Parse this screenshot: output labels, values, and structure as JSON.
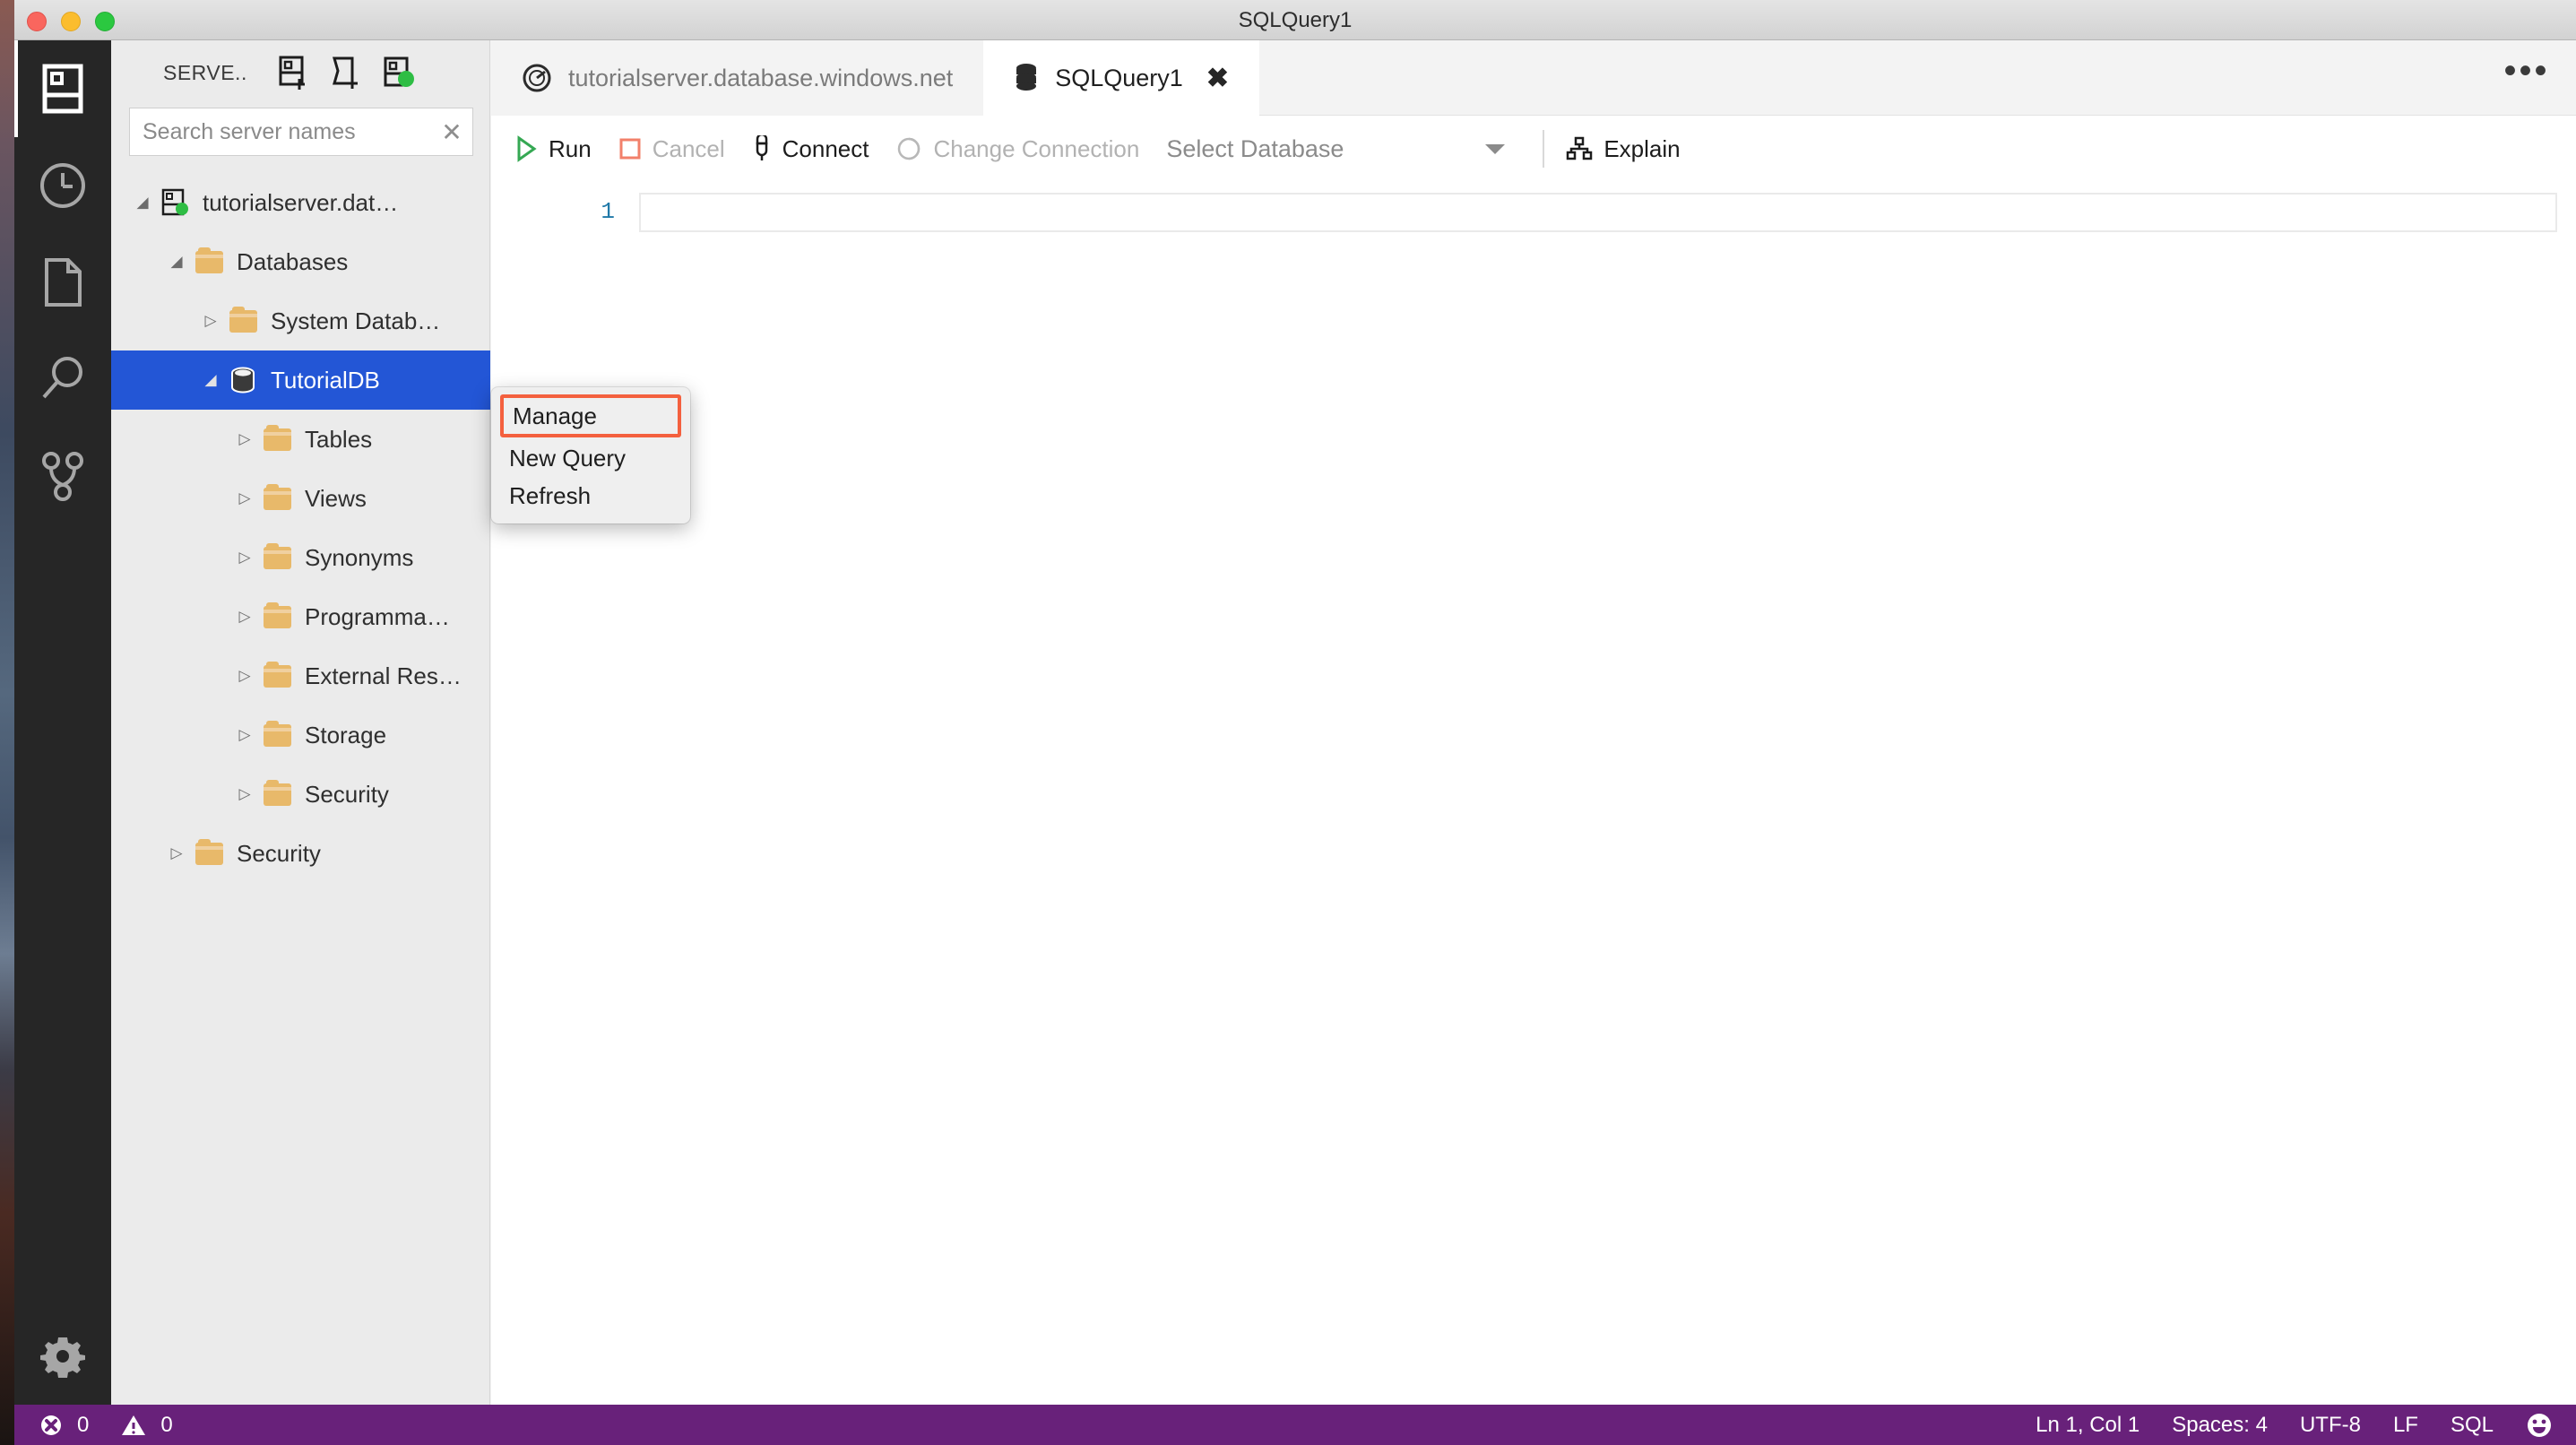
{
  "window": {
    "title": "SQLQuery1",
    "traffic_lights": [
      "close",
      "minimize",
      "maximize"
    ]
  },
  "activity_bar": {
    "items": [
      {
        "name": "servers",
        "icon": "servers-icon",
        "active": true
      },
      {
        "name": "history",
        "icon": "clock-icon",
        "active": false
      },
      {
        "name": "file-explorer",
        "icon": "file-icon",
        "active": false
      },
      {
        "name": "search",
        "icon": "magnifier-icon",
        "active": false
      },
      {
        "name": "source-control",
        "icon": "source-control-icon",
        "active": false
      }
    ],
    "bottom": [
      {
        "name": "settings",
        "icon": "gear-icon"
      }
    ]
  },
  "sidebar": {
    "title": "SERVE..",
    "actions": [
      {
        "name": "add-server",
        "icon": "add-server-icon"
      },
      {
        "name": "add-server-group",
        "icon": "add-server-group-icon"
      },
      {
        "name": "connected-server",
        "icon": "connected-server-icon"
      }
    ],
    "search": {
      "placeholder": "Search server names",
      "value": "",
      "clear_glyph": "✕"
    },
    "tree": [
      {
        "label": "tutorialserver.dat…",
        "icon": "server-connected-icon",
        "indent": 0,
        "twisty": "expanded",
        "selected": false
      },
      {
        "label": "Databases",
        "icon": "folder-icon",
        "indent": 1,
        "twisty": "expanded",
        "selected": false
      },
      {
        "label": "System Datab…",
        "icon": "folder-icon",
        "indent": 2,
        "twisty": "collapsed",
        "selected": false
      },
      {
        "label": "TutorialDB",
        "icon": "database-icon",
        "indent": 2,
        "twisty": "expanded",
        "selected": true
      },
      {
        "label": "Tables",
        "icon": "folder-icon",
        "indent": 3,
        "twisty": "collapsed",
        "selected": false
      },
      {
        "label": "Views",
        "icon": "folder-icon",
        "indent": 3,
        "twisty": "collapsed",
        "selected": false
      },
      {
        "label": "Synonyms",
        "icon": "folder-icon",
        "indent": 3,
        "twisty": "collapsed",
        "selected": false
      },
      {
        "label": "Programma…",
        "icon": "folder-icon",
        "indent": 3,
        "twisty": "collapsed",
        "selected": false
      },
      {
        "label": "External Res…",
        "icon": "folder-icon",
        "indent": 3,
        "twisty": "collapsed",
        "selected": false
      },
      {
        "label": "Storage",
        "icon": "folder-icon",
        "indent": 3,
        "twisty": "collapsed",
        "selected": false
      },
      {
        "label": "Security",
        "icon": "folder-icon",
        "indent": 3,
        "twisty": "collapsed",
        "selected": false
      },
      {
        "label": "Security",
        "icon": "folder-icon",
        "indent": 1,
        "twisty": "collapsed",
        "selected": false
      }
    ]
  },
  "context_menu": {
    "items": [
      {
        "label": "Manage",
        "highlighted": true
      },
      {
        "label": "New Query",
        "highlighted": false
      },
      {
        "label": "Refresh",
        "highlighted": false
      }
    ],
    "highlight_color": "#f4603e"
  },
  "tabs": [
    {
      "label": "tutorialserver.database.windows.net",
      "icon": "dashboard-gauge-icon",
      "active": false,
      "closable": false
    },
    {
      "label": "SQLQuery1",
      "icon": "database-stack-icon",
      "active": true,
      "closable": true,
      "close_glyph": "✖"
    }
  ],
  "tab_actions": {
    "more_label": "•••"
  },
  "toolbar": {
    "run_label": "Run",
    "cancel_label": "Cancel",
    "connect_label": "Connect",
    "change_connection_label": "Change Connection",
    "database_select_label": "Select Database",
    "explain_label": "Explain",
    "run_color": "#35a853",
    "cancel_color": "#f2806a"
  },
  "editor": {
    "line_numbers": [
      "1"
    ],
    "content": ""
  },
  "status_bar": {
    "errors_icon": "error-circle-icon",
    "errors_count": "0",
    "warnings_icon": "warning-triangle-icon",
    "warnings_count": "0",
    "cursor_position": "Ln 1, Col 1",
    "indentation": "Spaces: 4",
    "encoding": "UTF-8",
    "line_ending": "LF",
    "language": "SQL",
    "feedback_icon": "smiley-icon",
    "background": "#68217a"
  }
}
